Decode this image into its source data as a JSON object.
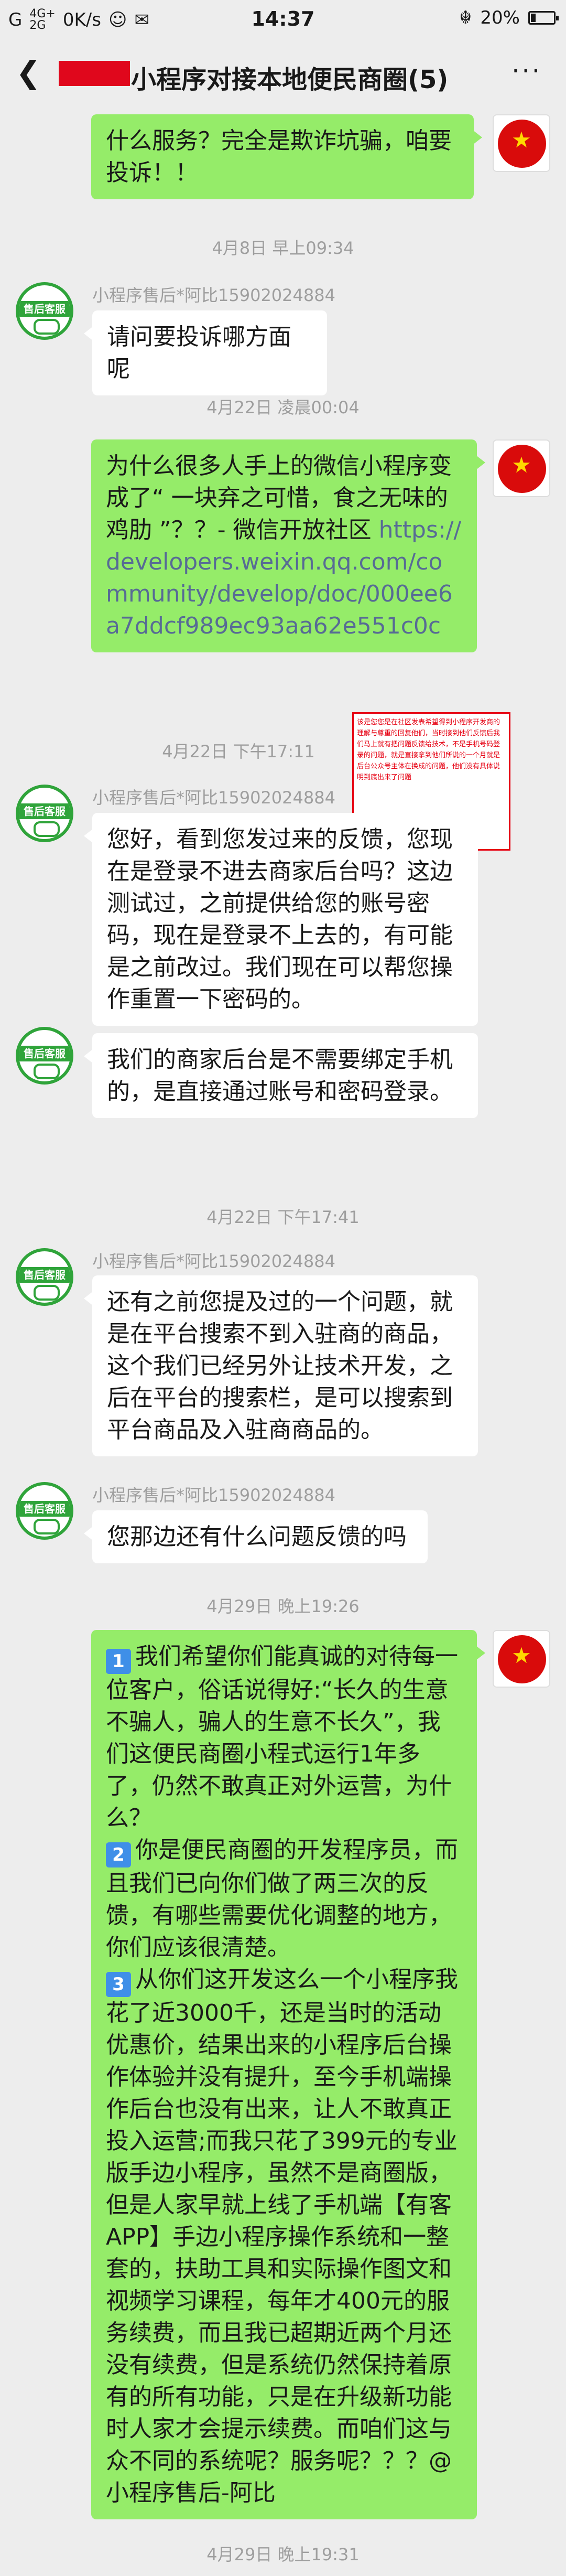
{
  "status_bar": {
    "signal": "G",
    "network_top": "4G+",
    "network_bottom": "2G",
    "speed": "0K/s",
    "time": "14:37",
    "battery": "20%"
  },
  "header": {
    "title": "小程序对接本地便民商圈(5)",
    "back_icon": "chevron-left-icon",
    "more_icon": "more-dots-icon"
  },
  "messages": {
    "m1": "什么服务？完全是欺诈坑骗，咱要投诉！！",
    "t1": "4月8日 早上09:34",
    "sender": "小程序售后*阿比15902024884",
    "m2": "请问要投诉哪方面呢",
    "t2": "4月22日 凌晨00:04",
    "m3_text": "为什么很多人手上的微信小程序变成了“ 一块弃之可惜，食之无味的鸡肋 ”？？- 微信开放社区 ",
    "m3_link": "https://developers.weixin.qq.com/community/develop/doc/000ee6a7ddcf989ec93aa62e551c0c",
    "t3": "4月22日 下午17:11",
    "m4": "您好，看到您发过来的反馈，您现在是登录不进去商家后台吗？这边测试过，之前提供给您的账号密码，现在是登录不上去的，有可能是之前改过。我们现在可以帮您操作重置一下密码的。",
    "m5": "我们的商家后台是不需要绑定手机的，是直接通过账号和密码登录。",
    "t4": "4月22日 下午17:41",
    "m6": "还有之前您提及过的一个问题，就是在平台搜索不到入驻商的商品，这个我们已经另外让技术开发，之后在平台的搜索栏，是可以搜索到平台商品及入驻商商品的。",
    "m7": "您那边还有什么问题反馈的吗",
    "t5": "4月29日 晚上19:26",
    "m8_p1": "我们希望你们能真诚的对待每一位客户，俗话说得好:“长久的生意不骗人，骗人的生意不长久”，我们这便民商圈小程式运行1年多了，仍然不敢真正对外运营，为什么？",
    "m8_p2": "你是便民商圈的开发程序员，而且我们已向你们做了两三次的反馈，有哪些需要优化调整的地方，你们应该很清楚。",
    "m8_p3": "从你们这开发这么一个小程序我花了近3000千，还是当时的活动优惠价，结果出来的小程序后台操作体验并没有提升，至今手机端操作后台也没有出来，让人不敢真正投入运营;而我只花了399元的专业版手边小程序，虽然不是商圈版，但是人家早就上线了手机端【有客APP】手边小程序操作系统和一整套的，扶助工具和实际操作图文和视频学习课程，每年才400元的服务续费，而且我已超期近两个月还没有续费，但是系统仍然保持着原有的所有功能，只是在升级新功能时人家才会提示续费。而咱们这与众不同的系统呢？服务呢？？？@小程序售后-阿比",
    "n1": "1",
    "n2": "2",
    "n3": "3",
    "t6": "4月29日 晚上19:31"
  },
  "annotation_note": "该是您您是在社区发表希望得到小程序开发商的理解与尊重的回复他们，当时接到他们反馈后我们马上就有把问题反馈给技术，不是手机号码登录的问题，就是直接拿到他们所说的一个月就是后台公众号主体在换成的问题，他们没有具体说明到底出来了问题",
  "avatar": {
    "other_label": "售后客服"
  }
}
